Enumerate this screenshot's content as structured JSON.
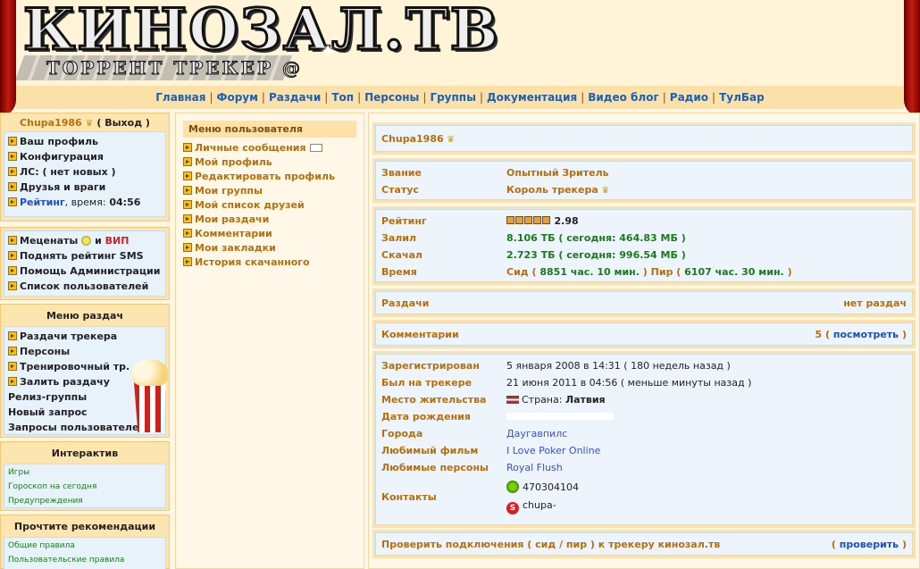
{
  "header": {
    "logo_main": "КИНОЗАЛ.ТВ",
    "logo_sub": "ТОРРЕНТ ТРЕКЕР @"
  },
  "topnav": [
    {
      "name": "nav-home",
      "label": "Главная"
    },
    {
      "name": "nav-forum",
      "label": "Форум"
    },
    {
      "name": "nav-releases",
      "label": "Раздачи"
    },
    {
      "name": "nav-top",
      "label": "Топ"
    },
    {
      "name": "nav-persons",
      "label": "Персоны"
    },
    {
      "name": "nav-groups",
      "label": "Группы"
    },
    {
      "name": "nav-docs",
      "label": "Документация"
    },
    {
      "name": "nav-videoblog",
      "label": "Видео блог"
    },
    {
      "name": "nav-radio",
      "label": "Радио"
    },
    {
      "name": "nav-toolbar",
      "label": "ТулБар"
    }
  ],
  "userbox": {
    "username": "Chupa1986",
    "logout": "( Выход )",
    "items": {
      "profile": "Ваш профиль",
      "config": "Конфигурация",
      "pm": "ЛС: ( нет новых )",
      "friends": "Друзья и враги",
      "rating_label": "Рейтинг",
      "time_label": ", время:",
      "time_value": "04:56"
    }
  },
  "sponsorbox": {
    "patrons": "Меценаты",
    "and": "и",
    "vip": "ВИП",
    "sms": "Поднять рейтинг SMS",
    "admin_help": "Помощь Администрации",
    "userlist": "Список пользователей"
  },
  "releasesbox": {
    "title": "Меню раздач",
    "tracker": "Раздачи трекера",
    "persons": "Персоны",
    "training": "Тренировочный тр.",
    "upload": "Залить раздачу",
    "groups": "Релиз-группы",
    "new_request": "Новый запрос",
    "user_requests": "Запросы пользователей"
  },
  "interactivebox": {
    "title": "Интерактив",
    "games": "Игры",
    "horoscope": "Гороскоп на сегодня",
    "warnings": "Предупреждения"
  },
  "rulesbox": {
    "title": "Прочтите рекомендации",
    "general": "Общие правила",
    "user": "Пользовательские правила"
  },
  "usermenu": {
    "title": "Меню пользователя",
    "items": [
      {
        "name": "menu-messages",
        "label": "Личные сообщения",
        "envelope": true
      },
      {
        "name": "menu-my-profile",
        "label": "Мой профиль"
      },
      {
        "name": "menu-edit-profile",
        "label": "Редактировать профиль"
      },
      {
        "name": "menu-my-groups",
        "label": "Мои группы"
      },
      {
        "name": "menu-friends-list",
        "label": "Мой список друзей"
      },
      {
        "name": "menu-my-releases",
        "label": "Мои раздачи"
      },
      {
        "name": "menu-comments",
        "label": "Комментарии"
      },
      {
        "name": "menu-bookmarks",
        "label": "Мои закладки"
      },
      {
        "name": "menu-download-history",
        "label": "История скачанного"
      }
    ]
  },
  "profile": {
    "username": "Chupa1986",
    "rank_label": "Звание",
    "rank_value": "Опытный Зритель",
    "status_label": "Статус",
    "status_value": "Король трекера",
    "rating_label": "Рейтинг",
    "rating_value": "2.98",
    "rating_stars": 5,
    "uploaded_label": "Залил",
    "uploaded_value": "8.106 ТБ ( сегодня: 464.83 МБ )",
    "downloaded_label": "Скачал",
    "downloaded_value": "2.723 ТБ ( сегодня: 996.54 МБ )",
    "time_label": "Время",
    "time_seed_label": "Сид (",
    "time_seed_value": "8851 час. 10 мин.",
    "time_peer_label": ") Пир (",
    "time_peer_value": "6107 час. 30 мин.",
    "time_end": ")",
    "releases_label": "Раздачи",
    "releases_value": "нет раздач",
    "comments_label": "Комментарии",
    "comments_count": "5",
    "comments_link": "посмотреть",
    "registered_label": "Зарегистрирован",
    "registered_value": "5 января 2008 в 14:31 ( 180 недель назад )",
    "lastseen_label": "Был на трекере",
    "lastseen_value": "21 июня 2011 в 04:56 ( меньше минуты назад )",
    "location_label": "Место жительства",
    "location_prefix": "Страна:",
    "location_value": "Латвия",
    "birthday_label": "Дата рождения",
    "city_label": "Города",
    "city_value": "Даугавпилс",
    "film_label": "Любимый фильм",
    "film_value": "I Love Poker Online",
    "persons_label": "Любимые персоны",
    "persons_value": "Royal Flush",
    "contacts_label": "Контакты",
    "icq_value": "470304104",
    "skype_value": "chupa-",
    "check_label": "Проверить подключения ( сид / пир ) к трекеру кинозал.тв",
    "check_link": "проверить"
  }
}
